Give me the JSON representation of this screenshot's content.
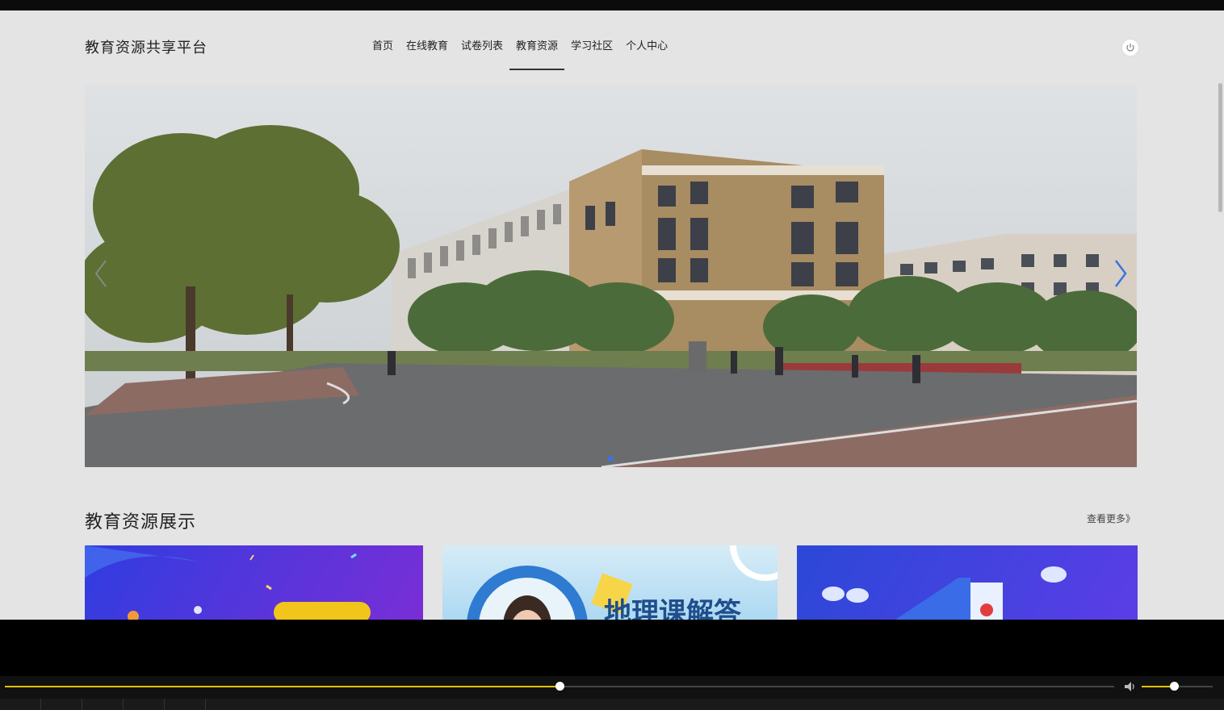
{
  "site": {
    "logo": "教育资源共享平台"
  },
  "nav": {
    "items": [
      {
        "label": "首页"
      },
      {
        "label": "在线教育"
      },
      {
        "label": "试卷列表"
      },
      {
        "label": "教育资源",
        "active": true
      },
      {
        "label": "学习社区"
      },
      {
        "label": "个人中心"
      }
    ]
  },
  "section": {
    "title": "教育资源展示",
    "more": "查看更多》"
  },
  "player": {
    "progress": 0.5,
    "volume": 0.45
  },
  "colors": {
    "accent": "#e4c200",
    "dot": "#3b72e5"
  },
  "icons": [
    "power-icon",
    "chevron-right-icon",
    "chevron-left-icon",
    "volume-icon"
  ]
}
